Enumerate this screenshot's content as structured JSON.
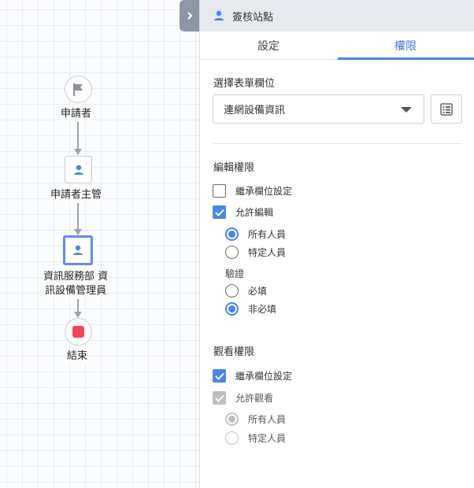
{
  "flow": {
    "nodes": [
      {
        "label": "申請者"
      },
      {
        "label": "申請者主管"
      },
      {
        "label_line1": "資訊服務部 資",
        "label_line2": "訊設備管理員"
      },
      {
        "label": "結束"
      }
    ]
  },
  "panel": {
    "title": "簽核站點",
    "tabs": [
      "設定",
      "權限"
    ],
    "active_tab": "權限",
    "field_select": {
      "title": "選擇表單欄位",
      "value": "連網設備資訊"
    },
    "edit": {
      "title": "編輯權限",
      "inherit_label": "繼承欄位設定",
      "inherit_checked": false,
      "allow_label": "允許編輯",
      "allow_checked": true,
      "scope_options": [
        "所有人員",
        "特定人員"
      ],
      "scope_selected": "所有人員",
      "validation_label": "驗證",
      "validation_options": [
        "必填",
        "非必填"
      ],
      "validation_selected": "非必填"
    },
    "view": {
      "title": "觀看權限",
      "inherit_label": "繼承欄位設定",
      "inherit_checked": true,
      "allow_label": "允許觀看",
      "allow_checked": true,
      "allow_disabled": true,
      "scope_options": [
        "所有人員",
        "特定人員"
      ],
      "scope_selected": "所有人員"
    }
  },
  "colors": {
    "accent": "#4a86e8",
    "end_node": "#f0485a",
    "connector": "#9ba3af"
  }
}
